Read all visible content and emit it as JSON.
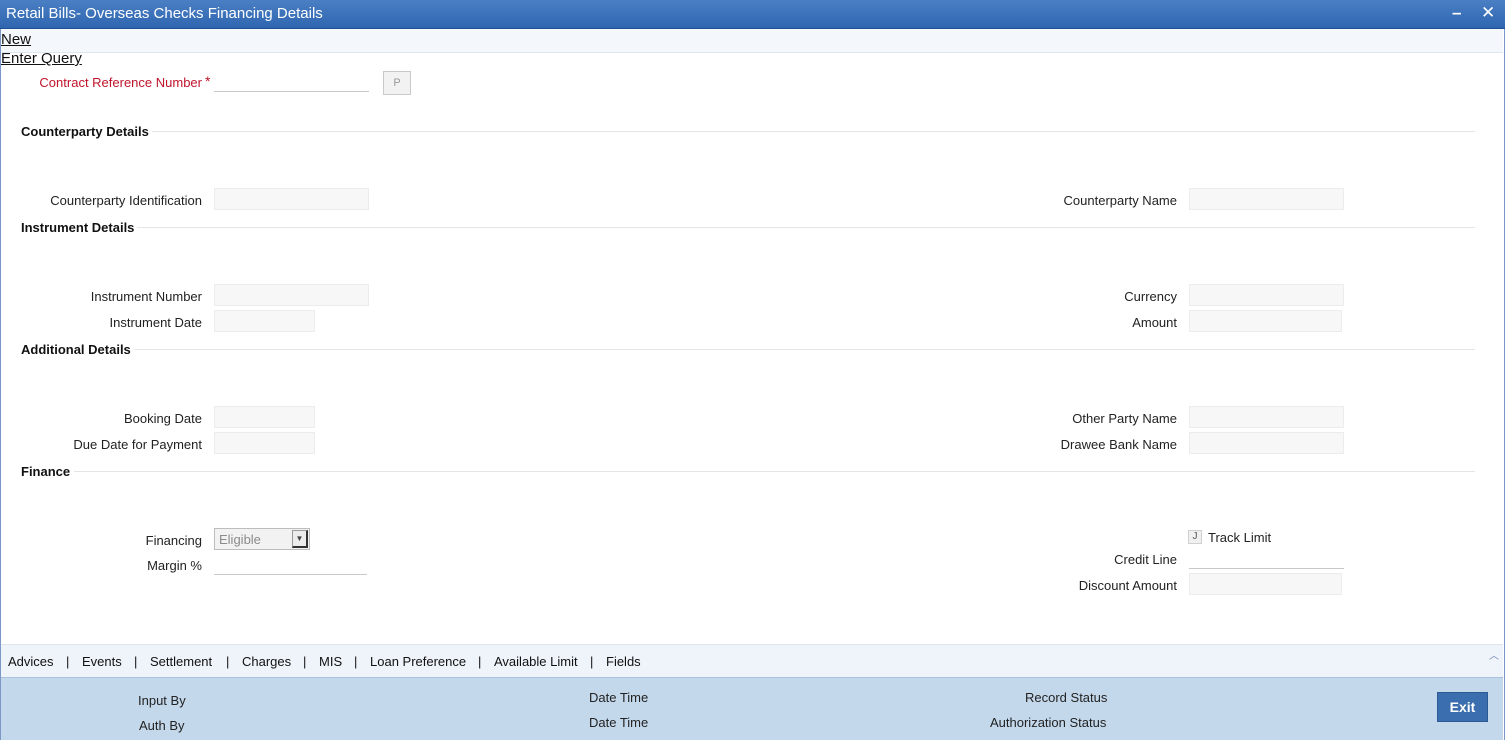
{
  "window": {
    "title": "Retail Bills- Overseas Checks Financing Details",
    "minimize_glyph": "–",
    "close_glyph": "✕"
  },
  "menu": {
    "new": "New",
    "enter_query": "Enter Query"
  },
  "contract": {
    "label": "Contract Reference Number",
    "required_mark": "*",
    "value": "",
    "p_button": "P"
  },
  "sections": {
    "counterparty": "Counterparty Details",
    "instrument": "Instrument Details",
    "additional": "Additional Details",
    "finance": "Finance"
  },
  "counterparty": {
    "identification_label": "Counterparty Identification",
    "identification_value": "",
    "name_label": "Counterparty Name",
    "name_value": ""
  },
  "instrument": {
    "number_label": "Instrument Number",
    "number_value": "",
    "date_label": "Instrument Date",
    "date_value": "",
    "currency_label": "Currency",
    "currency_value": "",
    "amount_label": "Amount",
    "amount_value": ""
  },
  "additional": {
    "booking_date_label": "Booking Date",
    "booking_date_value": "",
    "due_date_label": "Due Date for Payment",
    "due_date_value": "",
    "other_party_label": "Other Party Name",
    "other_party_value": "",
    "drawee_bank_label": "Drawee Bank Name",
    "drawee_bank_value": ""
  },
  "finance": {
    "financing_label": "Financing",
    "financing_selected": "Eligible",
    "margin_label": "Margin %",
    "margin_value": "",
    "track_limit_label": "Track Limit",
    "track_limit_checked": false,
    "credit_line_label": "Credit Line",
    "credit_line_value": "",
    "discount_amount_label": "Discount Amount",
    "discount_amount_value": ""
  },
  "tabs": [
    "Advices",
    "Events",
    "Settlement",
    "Charges",
    "MIS",
    "Loan Preference",
    "Available Limit",
    "Fields"
  ],
  "tab_separator": "|",
  "footer": {
    "input_by": "Input By",
    "auth_by": "Auth By",
    "date_time_1": "Date Time",
    "date_time_2": "Date Time",
    "record_status": "Record Status",
    "authorization_status": "Authorization Status",
    "exit": "Exit"
  },
  "colors": {
    "titlebar": "#2f66b0",
    "required": "#c0142c",
    "footer": "#c4d8ec",
    "exit_button": "#3b6eae"
  }
}
